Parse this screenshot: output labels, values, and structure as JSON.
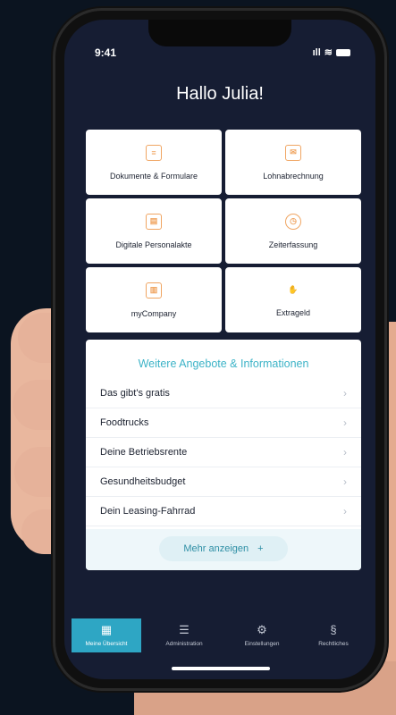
{
  "status": {
    "time": "9:41",
    "signal": "ıll",
    "wifi": "≋"
  },
  "greeting": "Hallo Julia!",
  "tiles": [
    {
      "label": "Dokumente & Formulare",
      "icon": "document-icon"
    },
    {
      "label": "Lohnabrechnung",
      "icon": "envelope-icon"
    },
    {
      "label": "Digitale Personalakte",
      "icon": "folder-icon"
    },
    {
      "label": "Zeiterfassung",
      "icon": "clock-icon"
    },
    {
      "label": "myCompany",
      "icon": "building-icon"
    },
    {
      "label": "Extrageld",
      "icon": "hand-coin-icon"
    }
  ],
  "panel": {
    "title": "Weitere Angebote & Informationen",
    "items": [
      "Das gibt's gratis",
      "Foodtrucks",
      "Deine Betriebsrente",
      "Gesundheitsbudget",
      "Dein Leasing-Fahrrad"
    ],
    "more_label": "Mehr anzeigen",
    "more_symbol": "+"
  },
  "tabs": [
    {
      "label": "Meine Übersicht",
      "icon": "grid-icon",
      "glyph": "▦",
      "active": true
    },
    {
      "label": "Administration",
      "icon": "sliders-icon",
      "glyph": "☰",
      "active": false
    },
    {
      "label": "Einstellungen",
      "icon": "gear-icon",
      "glyph": "⚙",
      "active": false
    },
    {
      "label": "Rechtliches",
      "icon": "paragraph-icon",
      "glyph": "§",
      "active": false
    }
  ],
  "colors": {
    "accent": "#2ea6c4",
    "tile_icon": "#f0a562",
    "screen_bg": "#161d33"
  }
}
